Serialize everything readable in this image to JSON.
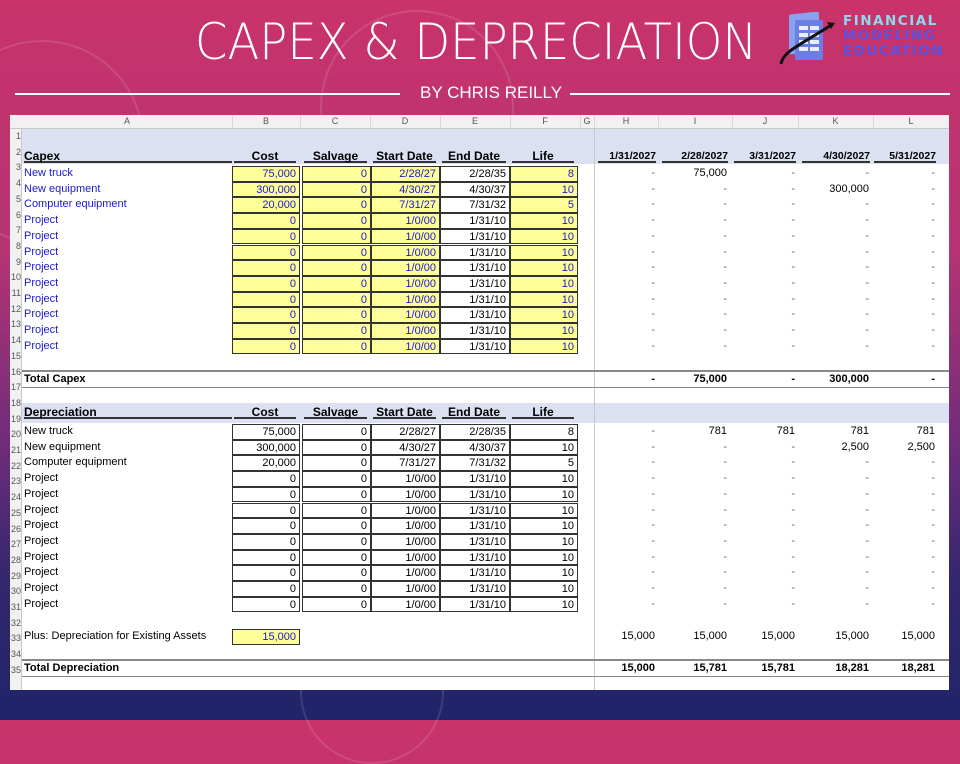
{
  "slide": {
    "title": "CAPEX & DEPRECIATION",
    "byline": "BY CHRIS REILLY",
    "logo": {
      "line1": "FINANCIAL",
      "line2": "MODELING",
      "line3": "EDUCATION"
    }
  },
  "sheet": {
    "column_letters": [
      "A",
      "B",
      "C",
      "D",
      "E",
      "F",
      "G",
      "H",
      "I",
      "J",
      "K",
      "L"
    ],
    "columns": [
      "Cost",
      "Salvage",
      "Start Date",
      "End Date",
      "Life"
    ],
    "periods": [
      "1/31/2027",
      "2/28/2027",
      "3/31/2027",
      "4/30/2027",
      "5/31/2027"
    ],
    "capex": {
      "title": "Capex",
      "rows": [
        {
          "name": "New truck",
          "cost": "75,000",
          "salvage": "0",
          "start": "2/28/27",
          "end": "2/28/35",
          "life": "8",
          "periods": [
            "-",
            "75,000",
            "-",
            "-",
            "-"
          ]
        },
        {
          "name": "New equipment",
          "cost": "300,000",
          "salvage": "0",
          "start": "4/30/27",
          "end": "4/30/37",
          "life": "10",
          "periods": [
            "-",
            "-",
            "-",
            "300,000",
            "-"
          ]
        },
        {
          "name": "Computer equipment",
          "cost": "20,000",
          "salvage": "0",
          "start": "7/31/27",
          "end": "7/31/32",
          "life": "5",
          "periods": [
            "-",
            "-",
            "-",
            "-",
            "-"
          ]
        },
        {
          "name": "Project",
          "cost": "0",
          "salvage": "0",
          "start": "1/0/00",
          "end": "1/31/10",
          "life": "10",
          "periods": [
            "-",
            "-",
            "-",
            "-",
            "-"
          ]
        },
        {
          "name": "Project",
          "cost": "0",
          "salvage": "0",
          "start": "1/0/00",
          "end": "1/31/10",
          "life": "10",
          "periods": [
            "-",
            "-",
            "-",
            "-",
            "-"
          ]
        },
        {
          "name": "Project",
          "cost": "0",
          "salvage": "0",
          "start": "1/0/00",
          "end": "1/31/10",
          "life": "10",
          "periods": [
            "-",
            "-",
            "-",
            "-",
            "-"
          ]
        },
        {
          "name": "Project",
          "cost": "0",
          "salvage": "0",
          "start": "1/0/00",
          "end": "1/31/10",
          "life": "10",
          "periods": [
            "-",
            "-",
            "-",
            "-",
            "-"
          ]
        },
        {
          "name": "Project",
          "cost": "0",
          "salvage": "0",
          "start": "1/0/00",
          "end": "1/31/10",
          "life": "10",
          "periods": [
            "-",
            "-",
            "-",
            "-",
            "-"
          ]
        },
        {
          "name": "Project",
          "cost": "0",
          "salvage": "0",
          "start": "1/0/00",
          "end": "1/31/10",
          "life": "10",
          "periods": [
            "-",
            "-",
            "-",
            "-",
            "-"
          ]
        },
        {
          "name": "Project",
          "cost": "0",
          "salvage": "0",
          "start": "1/0/00",
          "end": "1/31/10",
          "life": "10",
          "periods": [
            "-",
            "-",
            "-",
            "-",
            "-"
          ]
        },
        {
          "name": "Project",
          "cost": "0",
          "salvage": "0",
          "start": "1/0/00",
          "end": "1/31/10",
          "life": "10",
          "periods": [
            "-",
            "-",
            "-",
            "-",
            "-"
          ]
        },
        {
          "name": "Project",
          "cost": "0",
          "salvage": "0",
          "start": "1/0/00",
          "end": "1/31/10",
          "life": "10",
          "periods": [
            "-",
            "-",
            "-",
            "-",
            "-"
          ]
        }
      ],
      "total_label": "Total Capex",
      "total_periods": [
        "-",
        "75,000",
        "-",
        "300,000",
        "-"
      ]
    },
    "depreciation": {
      "title": "Depreciation",
      "rows": [
        {
          "name": "New truck",
          "cost": "75,000",
          "salvage": "0",
          "start": "2/28/27",
          "end": "2/28/35",
          "life": "8",
          "periods": [
            "-",
            "781",
            "781",
            "781",
            "781"
          ]
        },
        {
          "name": "New equipment",
          "cost": "300,000",
          "salvage": "0",
          "start": "4/30/27",
          "end": "4/30/37",
          "life": "10",
          "periods": [
            "-",
            "-",
            "-",
            "2,500",
            "2,500"
          ]
        },
        {
          "name": "Computer equipment",
          "cost": "20,000",
          "salvage": "0",
          "start": "7/31/27",
          "end": "7/31/32",
          "life": "5",
          "periods": [
            "-",
            "-",
            "-",
            "-",
            "-"
          ]
        },
        {
          "name": "Project",
          "cost": "0",
          "salvage": "0",
          "start": "1/0/00",
          "end": "1/31/10",
          "life": "10",
          "periods": [
            "-",
            "-",
            "-",
            "-",
            "-"
          ]
        },
        {
          "name": "Project",
          "cost": "0",
          "salvage": "0",
          "start": "1/0/00",
          "end": "1/31/10",
          "life": "10",
          "periods": [
            "-",
            "-",
            "-",
            "-",
            "-"
          ]
        },
        {
          "name": "Project",
          "cost": "0",
          "salvage": "0",
          "start": "1/0/00",
          "end": "1/31/10",
          "life": "10",
          "periods": [
            "-",
            "-",
            "-",
            "-",
            "-"
          ]
        },
        {
          "name": "Project",
          "cost": "0",
          "salvage": "0",
          "start": "1/0/00",
          "end": "1/31/10",
          "life": "10",
          "periods": [
            "-",
            "-",
            "-",
            "-",
            "-"
          ]
        },
        {
          "name": "Project",
          "cost": "0",
          "salvage": "0",
          "start": "1/0/00",
          "end": "1/31/10",
          "life": "10",
          "periods": [
            "-",
            "-",
            "-",
            "-",
            "-"
          ]
        },
        {
          "name": "Project",
          "cost": "0",
          "salvage": "0",
          "start": "1/0/00",
          "end": "1/31/10",
          "life": "10",
          "periods": [
            "-",
            "-",
            "-",
            "-",
            "-"
          ]
        },
        {
          "name": "Project",
          "cost": "0",
          "salvage": "0",
          "start": "1/0/00",
          "end": "1/31/10",
          "life": "10",
          "periods": [
            "-",
            "-",
            "-",
            "-",
            "-"
          ]
        },
        {
          "name": "Project",
          "cost": "0",
          "salvage": "0",
          "start": "1/0/00",
          "end": "1/31/10",
          "life": "10",
          "periods": [
            "-",
            "-",
            "-",
            "-",
            "-"
          ]
        },
        {
          "name": "Project",
          "cost": "0",
          "salvage": "0",
          "start": "1/0/00",
          "end": "1/31/10",
          "life": "10",
          "periods": [
            "-",
            "-",
            "-",
            "-",
            "-"
          ]
        }
      ],
      "existing_label": "Plus: Depreciation for Existing Assets",
      "existing_value": "15,000",
      "existing_periods": [
        "15,000",
        "15,000",
        "15,000",
        "15,000",
        "15,000"
      ],
      "total_label": "Total Depreciation",
      "total_periods": [
        "15,000",
        "15,781",
        "15,781",
        "18,281",
        "18,281"
      ]
    },
    "row_numbers": [
      "1",
      "2",
      "3",
      "4",
      "5",
      "6",
      "7",
      "8",
      "9",
      "10",
      "11",
      "12",
      "13",
      "14",
      "15",
      "16",
      "17",
      "18",
      "19",
      "20",
      "21",
      "22",
      "23",
      "24",
      "25",
      "26",
      "27",
      "28",
      "29",
      "30",
      "31",
      "32",
      "33",
      "34",
      "35"
    ]
  }
}
